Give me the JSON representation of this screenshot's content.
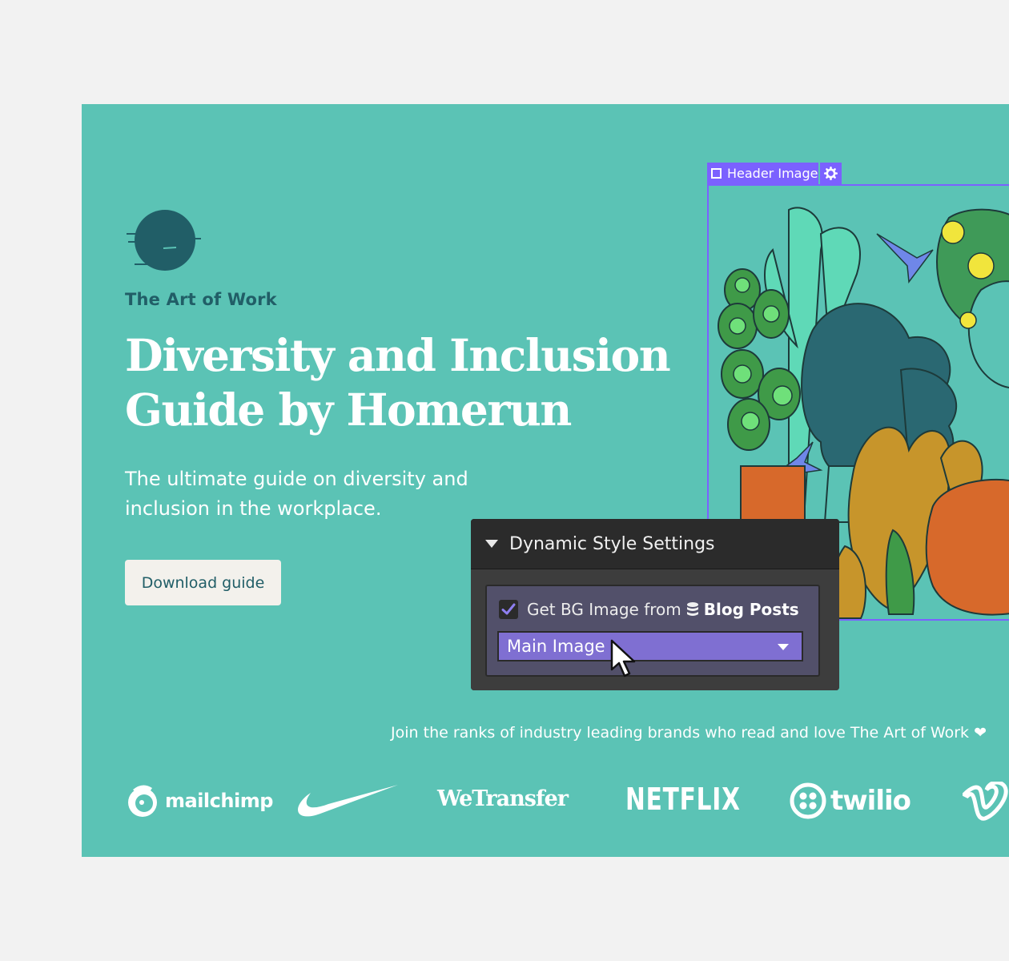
{
  "brand": {
    "name": "The Art of Work"
  },
  "hero": {
    "title_line1": "Diversity and Inclusion",
    "title_line2": "Guide by Homerun",
    "subtitle": "The ultimate guide on diversity and inclusion in the workplace.",
    "cta_label": "Download guide"
  },
  "header_image": {
    "label": "Header Image",
    "icon": "gear-icon"
  },
  "dynamic_style_panel": {
    "title": "Dynamic Style Settings",
    "checkbox_label": "Get BG Image from",
    "source_icon": "database-icon",
    "source_name": "Blog Posts",
    "checked": true,
    "select_value": "Main Image"
  },
  "brands_section": {
    "tagline": "Join the ranks of industry leading brands who read and love The Art of Work ❤",
    "logos": [
      "mailchimp",
      "Nike",
      "WeTransfer",
      "NETFLIX",
      "twilio",
      "Vimeo"
    ]
  },
  "colors": {
    "background": "#f2f2f2",
    "hero": "#5bc3b5",
    "dark_teal": "#215e67",
    "selection": "#7b61ff",
    "panel": "#2b2b2b",
    "select": "#7f6fd2"
  }
}
